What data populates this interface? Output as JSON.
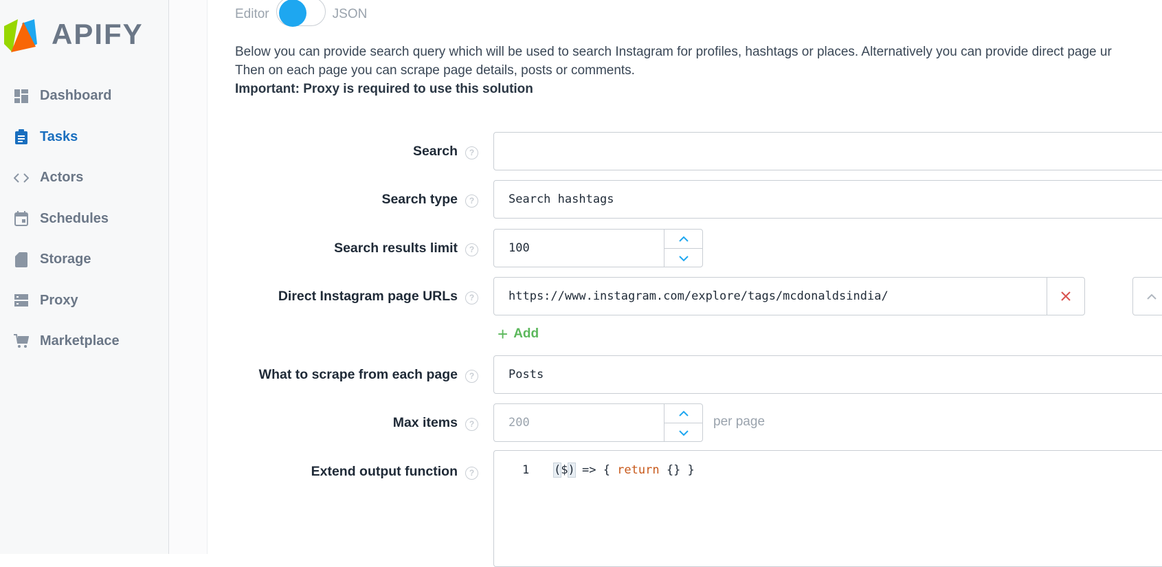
{
  "brand": {
    "name": "APIFY"
  },
  "sidebar": {
    "items": [
      {
        "label": "Dashboard",
        "icon": "dashboard-icon",
        "active": false
      },
      {
        "label": "Tasks",
        "icon": "clipboard-icon",
        "active": true
      },
      {
        "label": "Actors",
        "icon": "code-icon",
        "active": false
      },
      {
        "label": "Schedules",
        "icon": "calendar-icon",
        "active": false
      },
      {
        "label": "Storage",
        "icon": "sd-card-icon",
        "active": false
      },
      {
        "label": "Proxy",
        "icon": "server-icon",
        "active": false
      },
      {
        "label": "Marketplace",
        "icon": "cart-icon",
        "active": false
      }
    ]
  },
  "mode_toggle": {
    "left_label": "Editor",
    "right_label": "JSON"
  },
  "description": {
    "line1": "Below you can provide search query which will be used to search Instagram for profiles, hashtags or places. Alternatively you can provide direct page ur",
    "line2": "Then on each page you can scrape page details, posts or comments.",
    "line3": "Important: Proxy is required to use this solution"
  },
  "form": {
    "search": {
      "label": "Search",
      "value": ""
    },
    "search_type": {
      "label": "Search type",
      "value": "Search hashtags"
    },
    "search_results_limit": {
      "label": "Search results limit",
      "value": "100"
    },
    "direct_urls": {
      "label": "Direct Instagram page URLs",
      "value": "https://www.instagram.com/explore/tags/mcdonaldsindia/",
      "add_label": "Add"
    },
    "what_to_scrape": {
      "label": "What to scrape from each page",
      "value": "Posts"
    },
    "max_items": {
      "label": "Max items",
      "placeholder": "200",
      "suffix": "per page"
    },
    "extend_output": {
      "label": "Extend output function",
      "line_number": "1",
      "code_prefix": "(",
      "code_param": "$",
      "code_close": ")",
      "code_arrow": " => { ",
      "code_keyword": "return",
      "code_suffix": " {} }"
    }
  },
  "colors": {
    "accent": "#1a6fbf",
    "toggle": "#1ea7f0",
    "add": "#5cb85c",
    "remove": "#d9534f",
    "keyword": "#c8591b"
  }
}
